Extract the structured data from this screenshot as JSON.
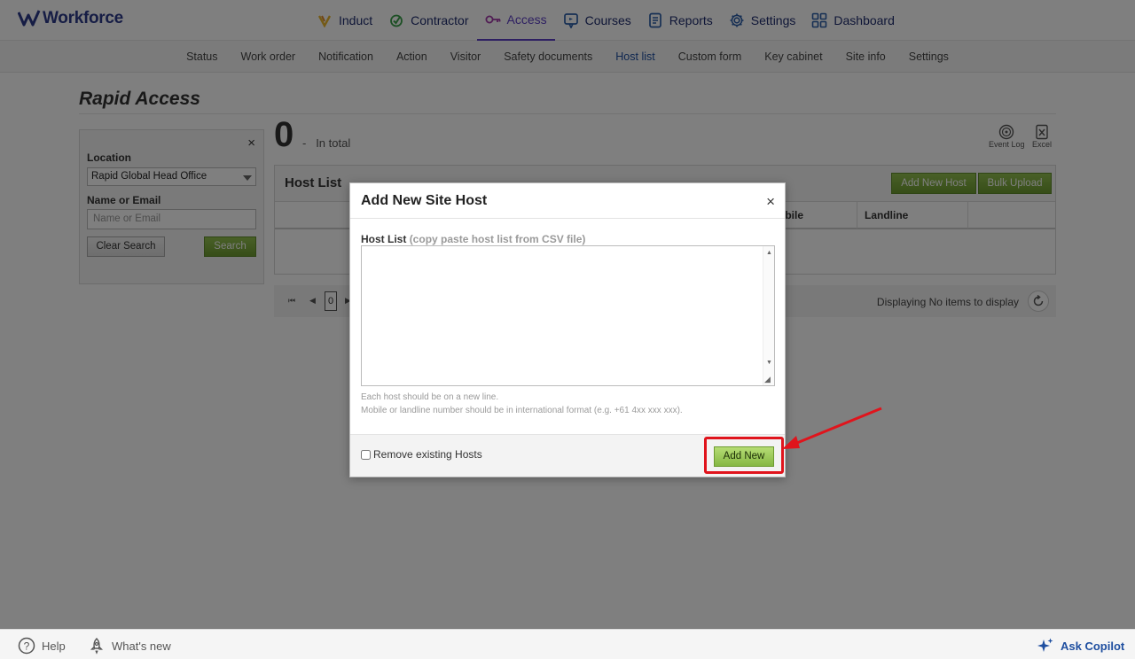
{
  "app": {
    "logo_text": "Workforce"
  },
  "main_nav": [
    {
      "label": "Induct",
      "icon": "induct-icon"
    },
    {
      "label": "Contractor",
      "icon": "contractor-icon"
    },
    {
      "label": "Access",
      "icon": "key-icon",
      "active": true
    },
    {
      "label": "Courses",
      "icon": "courses-icon"
    },
    {
      "label": "Reports",
      "icon": "reports-icon"
    },
    {
      "label": "Settings",
      "icon": "gear-icon"
    },
    {
      "label": "Dashboard",
      "icon": "dashboard-icon"
    }
  ],
  "sub_nav": [
    {
      "label": "Status"
    },
    {
      "label": "Work order"
    },
    {
      "label": "Notification"
    },
    {
      "label": "Action"
    },
    {
      "label": "Visitor"
    },
    {
      "label": "Safety documents"
    },
    {
      "label": "Host list",
      "active": true
    },
    {
      "label": "Custom form"
    },
    {
      "label": "Key cabinet"
    },
    {
      "label": "Site info"
    },
    {
      "label": "Settings"
    }
  ],
  "page": {
    "title": "Rapid Access",
    "total_count": "0",
    "total_separator": "-",
    "total_label": "In total",
    "event_log_label": "Event Log",
    "excel_label": "Excel"
  },
  "search_panel": {
    "close": "×",
    "location_label": "Location",
    "location_value": "Rapid Global Head Office",
    "name_label": "Name or Email",
    "name_placeholder": "Name or Email",
    "clear_label": "Clear Search",
    "search_label": "Search"
  },
  "host_list": {
    "title": "Host List",
    "add_button": "Add New Host",
    "bulk_button": "Bulk Upload",
    "columns": [
      "obile",
      "Landline"
    ]
  },
  "pager": {
    "first": "⏮",
    "prev": "◀",
    "page": "0",
    "next": "▶",
    "info": "Displaying No items to display"
  },
  "modal": {
    "title": "Add New Site Host",
    "close": "×",
    "field_label": "Host List",
    "field_hint": "(copy paste host list from CSV file)",
    "textarea_value": "",
    "note_1": "Each host should be on a new line.",
    "note_2": "Mobile or landline number should be in international format (e.g. +61 4xx xxx xxx).",
    "remove_label": "Remove existing Hosts",
    "remove_checked": false,
    "add_button": "Add New"
  },
  "footer": {
    "help": "Help",
    "whats_new": "What's new",
    "copilot": "Ask Copilot"
  },
  "colors": {
    "brand": "#2c3a8a",
    "active_nav": "#5c3fc4",
    "green_button": "#7aa83a",
    "highlight": "#e0141c"
  }
}
